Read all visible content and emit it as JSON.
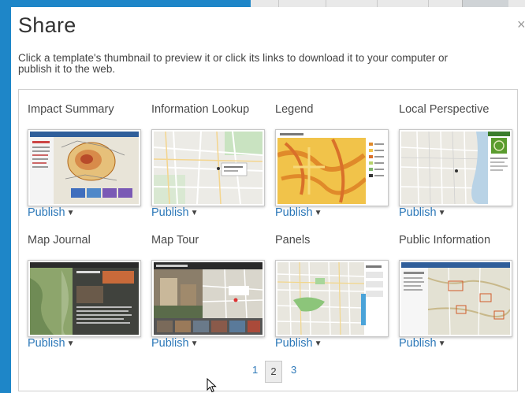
{
  "dialog": {
    "title": "Share",
    "close_glyph": "×",
    "description_line1": "Click a template's thumbnail to preview it or click its links to download it to your computer or",
    "description_line2": "publish it to the web."
  },
  "templates": [
    {
      "name": "Impact Summary",
      "publish_label": "Publish",
      "thumb": "impact-summary-map"
    },
    {
      "name": "Information Lookup",
      "publish_label": "Publish",
      "thumb": "information-lookup-map"
    },
    {
      "name": "Legend",
      "publish_label": "Publish",
      "thumb": "legend-map"
    },
    {
      "name": "Local Perspective",
      "publish_label": "Publish",
      "thumb": "local-perspective-map"
    },
    {
      "name": "Map Journal",
      "publish_label": "Publish",
      "thumb": "map-journal-map"
    },
    {
      "name": "Map Tour",
      "publish_label": "Publish",
      "thumb": "map-tour-map"
    },
    {
      "name": "Panels",
      "publish_label": "Publish",
      "thumb": "panels-map"
    },
    {
      "name": "Public Information",
      "publish_label": "Publish",
      "thumb": "public-information-map"
    }
  ],
  "pager": {
    "pages": [
      "1",
      "2",
      "3"
    ],
    "current": "2"
  },
  "colors": {
    "background_blue": "#1e86c8",
    "link_blue": "#2b77b8"
  },
  "icons": {
    "dropdown": "caret-down-icon",
    "close": "close-icon",
    "cursor": "mouse-pointer-icon"
  }
}
